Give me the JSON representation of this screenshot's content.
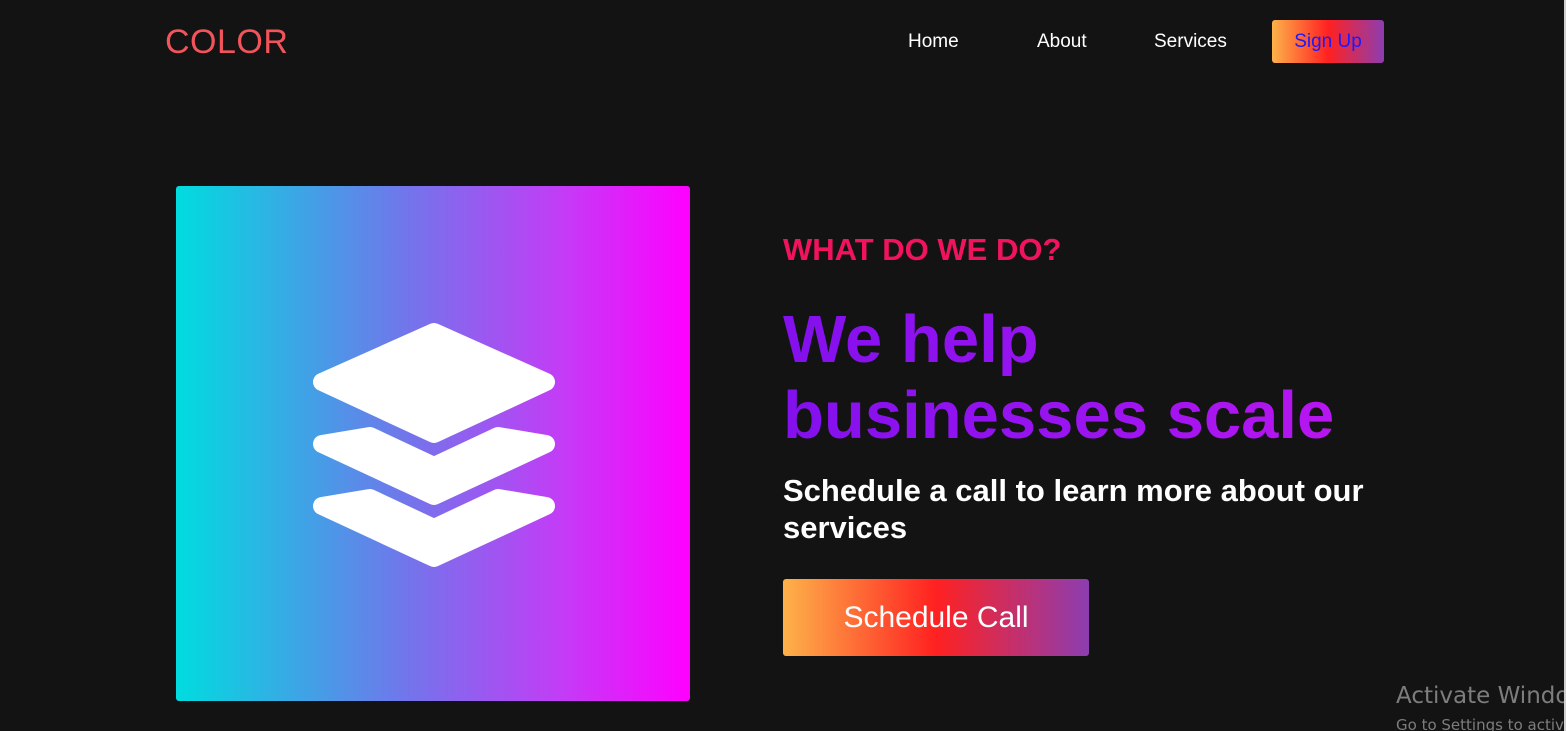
{
  "brand": {
    "logo_text": "COLOR",
    "logo_color": "#f2545b"
  },
  "nav": {
    "links": [
      {
        "label": "Home"
      },
      {
        "label": "About"
      },
      {
        "label": "Services"
      }
    ],
    "signup_label": "Sign Up"
  },
  "hero": {
    "image_icon": "layers-icon",
    "eyebrow": "WHAT DO WE DO?",
    "headline_line1": "We help",
    "headline_line2": "businesses scale",
    "subheadline": "Schedule a call to learn more about our services",
    "cta_label": "Schedule Call"
  },
  "watermark": {
    "title": "Activate Windows",
    "subtitle": "Go to Settings to activate Windows."
  },
  "colors": {
    "background": "#131313",
    "eyebrow": "#f2135f",
    "headline": "#8e12ee",
    "button_gradient": [
      "#fdb24a",
      "#ff2121",
      "#8c3db1"
    ],
    "image_gradient": [
      "#00dcdf",
      "#ff00ff"
    ]
  }
}
